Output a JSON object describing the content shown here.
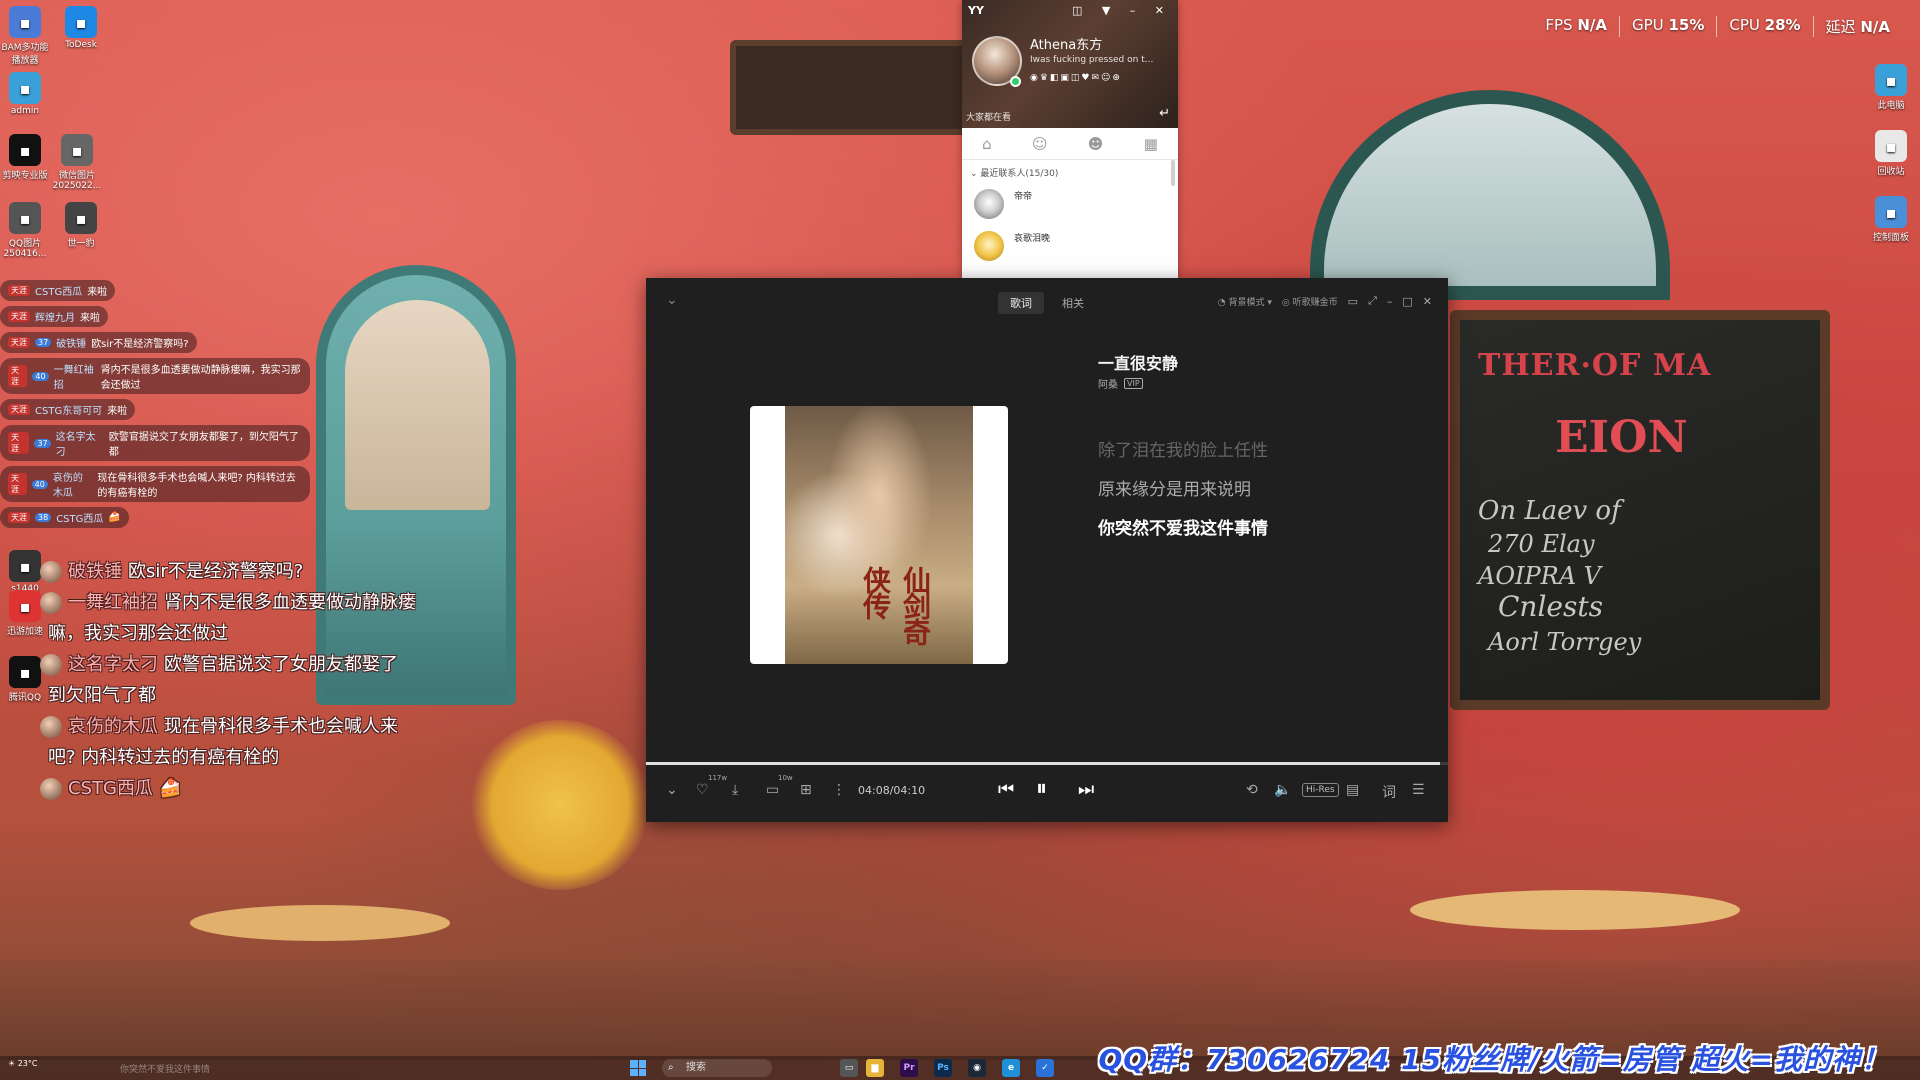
{
  "stats": [
    {
      "label": "FPS",
      "value": "N/A"
    },
    {
      "label": "GPU",
      "value": "15%"
    },
    {
      "label": "CPU",
      "value": "28%"
    },
    {
      "label": "延迟",
      "value": "N/A"
    }
  ],
  "desktop_left": [
    {
      "label": "BAM多功能播放器",
      "icon": "app-icon",
      "color": "#4a7bd6"
    },
    {
      "label": "ToDesk",
      "icon": "todesk-icon",
      "color": "#1e88e5"
    },
    {
      "label": "admin",
      "icon": "user-icon",
      "color": "#3aa0d8"
    },
    {
      "label": "剪映专业版",
      "icon": "capcut-icon",
      "color": "#111111"
    },
    {
      "label": "微信图片 2025022...",
      "icon": "image-icon",
      "color": "#666666"
    },
    {
      "label": "QQ图片 250416...",
      "icon": "image-icon",
      "color": "#555555"
    },
    {
      "label": "世一豹",
      "icon": "image-icon",
      "color": "#444444"
    },
    {
      "label": "s1440",
      "icon": "app-icon",
      "color": "#333333"
    },
    {
      "label": "迅游加速",
      "icon": "app-icon",
      "color": "#d33"
    },
    {
      "label": "腾讯QQ",
      "icon": "qq-icon",
      "color": "#111111"
    }
  ],
  "desktop_right": [
    {
      "label": "此电脑",
      "icon": "computer-icon",
      "color": "#3aa0d8"
    },
    {
      "label": "回收站",
      "icon": "recycle-bin-icon",
      "color": "#e8e8e8"
    },
    {
      "label": "控制面板",
      "icon": "control-panel-icon",
      "color": "#4a90d9"
    }
  ],
  "chat_small": [
    {
      "badge": "天涯",
      "nick": "CSTG西瓜",
      "msg": "来啦"
    },
    {
      "badge": "天涯",
      "nick": "辉煌九月",
      "msg": "来啦"
    },
    {
      "badge": "天涯",
      "fan": "37",
      "nick": "破铁锤",
      "msg": "欧sir不是经济警察吗?"
    },
    {
      "badge": "天涯",
      "fan": "40",
      "nick": "一舞红袖招",
      "msg": "肾内不是很多血透要做动静脉瘘嘛，我实习那会还做过"
    },
    {
      "badge": "天涯",
      "nick": "CSTG东哥可可",
      "msg": "来啦"
    },
    {
      "badge": "天涯",
      "fan": "37",
      "nick": "这名字太刁",
      "msg": "欧警官据说交了女朋友都娶了，到欠阳气了都"
    },
    {
      "badge": "天涯",
      "fan": "40",
      "nick": "哀伤的木瓜",
      "msg": "现在骨科很多手术也会喊人来吧? 内科转过去的有癌有栓的"
    },
    {
      "badge": "天涯",
      "fan": "38",
      "nick": "CSTG西瓜",
      "msg": "🍰"
    }
  ],
  "chat_big": [
    {
      "nick": "破铁锤",
      "msg": "欧sir不是经济警察吗?",
      "cont": ""
    },
    {
      "nick": "一舞红袖招",
      "msg": "肾内不是很多血透要做动静脉瘘",
      "cont": "嘛，我实习那会还做过"
    },
    {
      "nick": "这名字太刁",
      "msg": "欧警官据说交了女朋友都娶了",
      "cont": "到欠阳气了都"
    },
    {
      "nick": "哀伤的木瓜",
      "msg": "现在骨科很多手术也会喊人来",
      "cont": "吧? 内科转过去的有癌有栓的"
    },
    {
      "nick": "CSTG西瓜",
      "msg": "🍰",
      "cont": ""
    }
  ],
  "qq": {
    "logo": "YY",
    "name": "Athena东方",
    "signature": "Iwas fucking pressed on t...",
    "search_label": "大家都在看",
    "group_label": "最近联系人(15/30)",
    "contacts": [
      {
        "name": "帝帝",
        "color": "#dddddd"
      },
      {
        "name": "哀歌泪晚",
        "color": "#f2c64a"
      }
    ]
  },
  "player": {
    "tabs": [
      "歌词",
      "相关"
    ],
    "top_actions": [
      "背景模式",
      "听歌赚金币"
    ],
    "song_title": "一直很安静",
    "artist": "阿桑",
    "vip": "VIP",
    "lyrics": [
      "除了泪在我的脸上任性",
      "原来缘分是用来说明",
      "你突然不爱我这件事情"
    ],
    "cover_caption": "仙剑奇侠传",
    "time": "04:08/04:10",
    "progress": 0.99,
    "like_count": "117w",
    "download_count": "10w",
    "hires": "Hi-Res",
    "lyric_toggle": "词"
  },
  "taskbar": {
    "weather": "23°C",
    "search_placeholder": "搜索",
    "caption": "你突然不爱我这件事情"
  },
  "banner": "QQ群：730626724   15粉丝牌/火箭=房管   超火=我的神！",
  "chalkboard": {
    "title": "THER·OF MA",
    "sub": "EION",
    "notes": [
      "On Laev of",
      "270 Elay",
      "AOIPRA V",
      "Cnlests",
      "Aorl Torrgey"
    ]
  }
}
